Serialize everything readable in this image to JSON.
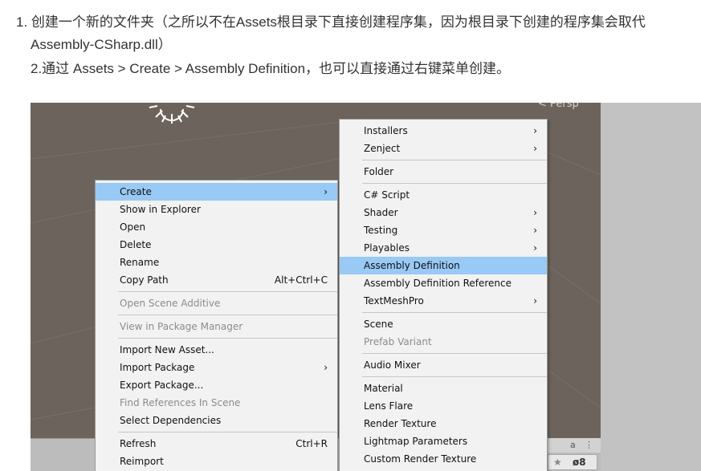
{
  "doc": {
    "line1": "1. 创建一个新的文件夹（之所以不在Assets根目录下直接创建程序集，因为根目录下创建的程序集会取代",
    "line2": "Assembly-CSharp.dll）",
    "line3": "2.通过 Assets > Create > Assembly Definition，也可以直接通过右键菜单创建。"
  },
  "scene": {
    "persp_label": "< Persp",
    "background_color": "#6c645c",
    "sun_icon": "sun-icon"
  },
  "bottom": {
    "lock_label": "a",
    "more_label": "⋮",
    "star_label": "★",
    "hidden_count_label": "ø8"
  },
  "context_menu": {
    "items": [
      {
        "label": "Create",
        "arrow": "›",
        "highlighted": true
      },
      {
        "label": "Show in Explorer"
      },
      {
        "label": "Open"
      },
      {
        "label": "Delete"
      },
      {
        "label": "Rename"
      },
      {
        "label": "Copy Path",
        "shortcut": "Alt+Ctrl+C"
      },
      {
        "label": "Open Scene Additive",
        "disabled": true
      },
      {
        "label": "View in Package Manager",
        "disabled": true
      },
      {
        "label": "Import New Asset..."
      },
      {
        "label": "Import Package",
        "arrow": "›"
      },
      {
        "label": "Export Package..."
      },
      {
        "label": "Find References In Scene",
        "disabled": true
      },
      {
        "label": "Select Dependencies"
      },
      {
        "label": "Refresh",
        "shortcut": "Ctrl+R"
      },
      {
        "label": "Reimport"
      }
    ]
  },
  "create_submenu": {
    "items": [
      {
        "label": "Installers",
        "arrow": "›"
      },
      {
        "label": "Zenject",
        "arrow": "›"
      },
      {
        "label": "Folder"
      },
      {
        "label": "C# Script"
      },
      {
        "label": "Shader",
        "arrow": "›"
      },
      {
        "label": "Testing",
        "arrow": "›"
      },
      {
        "label": "Playables",
        "arrow": "›"
      },
      {
        "label": "Assembly Definition",
        "highlighted": true
      },
      {
        "label": "Assembly Definition Reference"
      },
      {
        "label": "TextMeshPro",
        "arrow": "›"
      },
      {
        "label": "Scene"
      },
      {
        "label": "Prefab Variant",
        "disabled": true
      },
      {
        "label": "Audio Mixer"
      },
      {
        "label": "Material"
      },
      {
        "label": "Lens Flare"
      },
      {
        "label": "Render Texture"
      },
      {
        "label": "Lightmap Parameters"
      },
      {
        "label": "Custom Render Texture"
      }
    ]
  },
  "colors": {
    "highlight": "#99c9f5",
    "menu_bg": "#f2f2f2",
    "disabled_text": "#8c8c8c"
  }
}
